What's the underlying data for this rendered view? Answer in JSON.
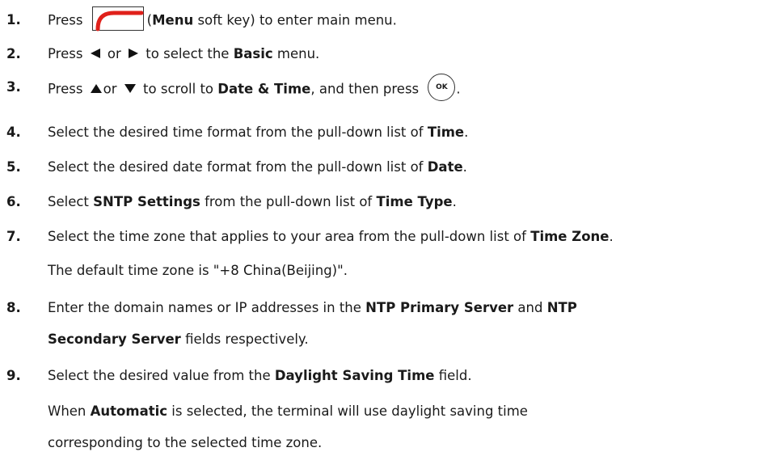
{
  "steps": [
    {
      "num": "1.",
      "parts": [
        "Press ",
        "",
        "(",
        "Menu",
        " soft key) to enter main menu."
      ]
    },
    {
      "num": "2.",
      "parts": [
        "Press ",
        " or ",
        " to select the ",
        "Basic",
        " menu."
      ]
    },
    {
      "num": "3.",
      "parts": [
        "Press ",
        "or ",
        " to scroll to ",
        "Date & Time",
        ", and then press ",
        "OK",
        "."
      ]
    },
    {
      "num": "4.",
      "parts": [
        "Select the desired time format from the pull-down list of ",
        "Time",
        "."
      ]
    },
    {
      "num": "5.",
      "parts": [
        "Select the desired date format from the pull-down list of ",
        "Date",
        "."
      ]
    },
    {
      "num": "6.",
      "parts": [
        "Select ",
        "SNTP Settings",
        " from the pull-down list of ",
        "Time Type",
        "."
      ]
    },
    {
      "num": "7.",
      "parts": [
        "Select the time zone that applies to your area from the pull-down list of ",
        "Time Zone",
        "."
      ],
      "extra": "The default time zone is \"+8 China(Beijing)\"."
    },
    {
      "num": "8.",
      "parts": [
        "Enter the domain names or IP addresses in the ",
        "NTP Primary Server",
        " and ",
        "NTP"
      ],
      "cont": [
        "Secondary Server",
        " fields respectively."
      ]
    },
    {
      "num": "9.",
      "parts": [
        "Select the desired value from the ",
        "Daylight Saving Time",
        " field."
      ],
      "extra1": [
        "When ",
        "Automatic",
        " is selected, the terminal will use daylight saving time"
      ],
      "extra2": "corresponding to the selected time zone."
    }
  ],
  "icons": {
    "menu_key": "menu-soft-key-icon",
    "left_arrow": "left-arrow-icon",
    "right_arrow": "right-arrow-icon",
    "up_arrow": "up-arrow-icon",
    "down_arrow": "down-arrow-icon",
    "ok_key": "ok-key-icon",
    "accent": "#e0211b"
  }
}
